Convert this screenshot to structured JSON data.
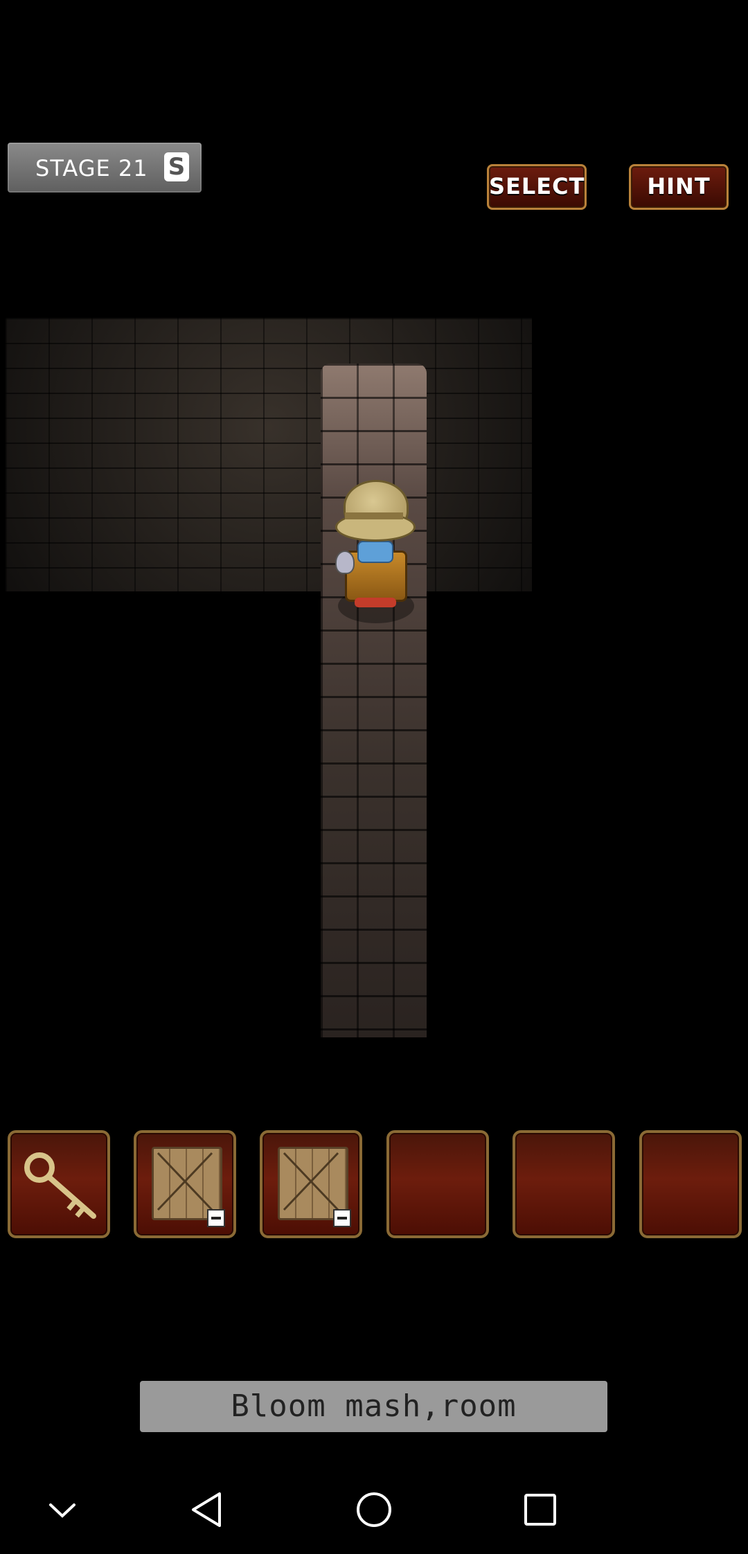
{
  "stage": {
    "label": "STAGE 21",
    "rank_letter": "S"
  },
  "buttons": {
    "select": "SELECT",
    "hint": "HINT"
  },
  "inventory": [
    {
      "item": "key-icon"
    },
    {
      "item": "crate-icon",
      "badge": "minus-icon"
    },
    {
      "item": "crate-icon",
      "badge": "minus-icon"
    },
    {
      "item": ""
    },
    {
      "item": ""
    },
    {
      "item": ""
    }
  ],
  "caption": "Bloom mash,room",
  "navigation": [
    "collapse-icon",
    "back-icon",
    "home-icon",
    "recents-icon"
  ],
  "colors": {
    "button_red": "#6d1c0e",
    "button_border": "#b9823a",
    "caption_bg": "#9a9a9a"
  }
}
